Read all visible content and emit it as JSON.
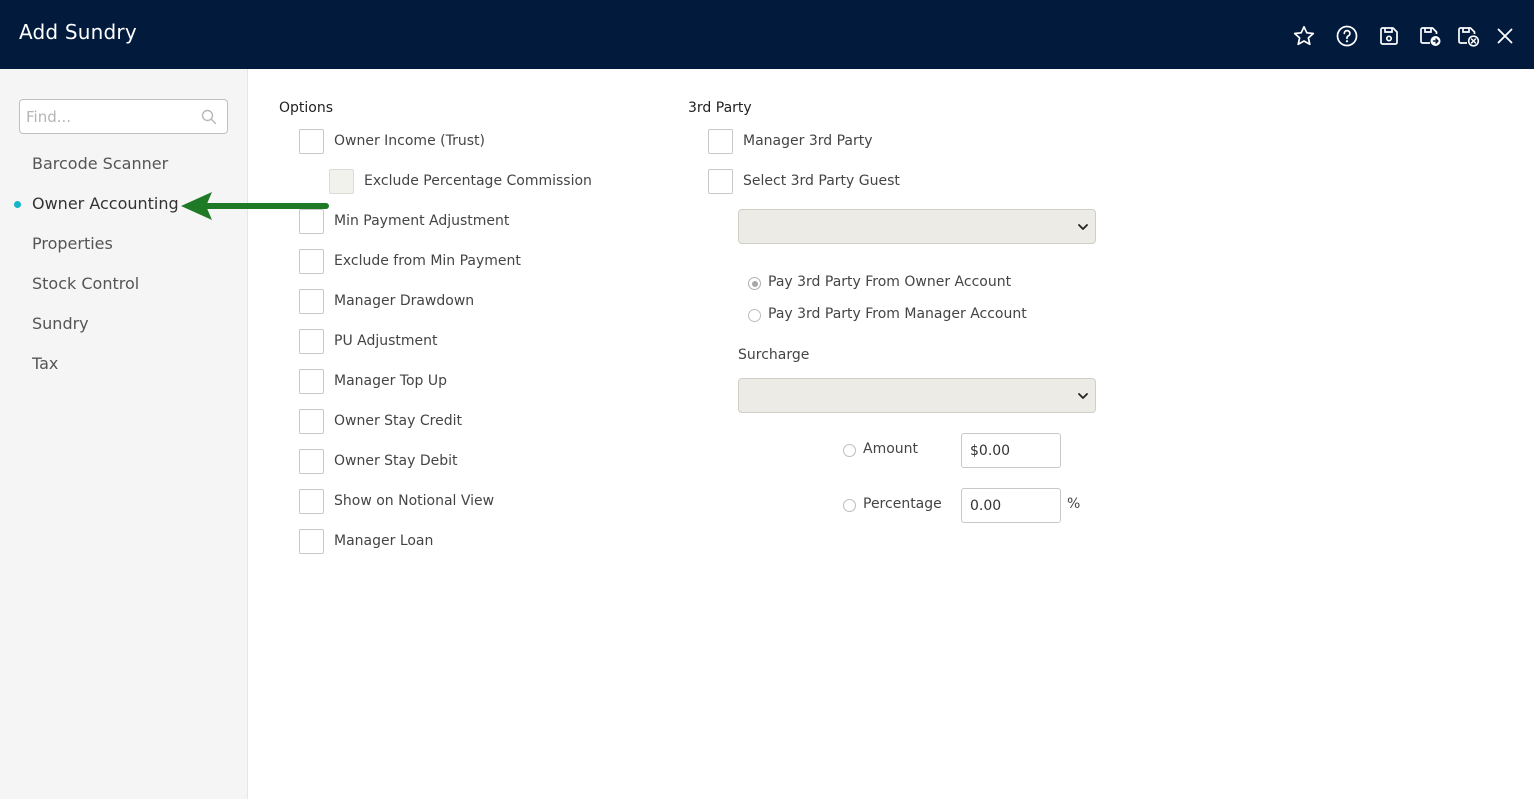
{
  "header": {
    "title": "Add Sundry",
    "icons": [
      "star-icon",
      "help-icon",
      "save-icon",
      "save-and-new-icon",
      "save-and-close-icon",
      "close-icon"
    ]
  },
  "sidebar": {
    "search_placeholder": "Find...",
    "items": [
      {
        "label": "Barcode Scanner",
        "active": false
      },
      {
        "label": "Owner Accounting",
        "active": true
      },
      {
        "label": "Properties",
        "active": false
      },
      {
        "label": "Stock Control",
        "active": false
      },
      {
        "label": "Sundry",
        "active": false
      },
      {
        "label": "Tax",
        "active": false
      }
    ]
  },
  "options": {
    "title": "Options",
    "items": [
      {
        "label": "Owner Income (Trust)",
        "checked": false
      },
      {
        "label": "Exclude Percentage Commission",
        "checked": false,
        "disabled": true
      },
      {
        "label": "Min Payment Adjustment",
        "checked": false
      },
      {
        "label": "Exclude from Min Payment",
        "checked": false
      },
      {
        "label": "Manager Drawdown",
        "checked": false
      },
      {
        "label": "PU Adjustment",
        "checked": false
      },
      {
        "label": "Manager Top Up",
        "checked": false
      },
      {
        "label": "Owner Stay Credit",
        "checked": false
      },
      {
        "label": "Owner Stay Debit",
        "checked": false
      },
      {
        "label": "Show on Notional View",
        "checked": false
      },
      {
        "label": "Manager Loan",
        "checked": false
      }
    ]
  },
  "third_party": {
    "title": "3rd Party",
    "manager_3rd_party": "Manager 3rd Party",
    "select_guest": "Select 3rd Party Guest",
    "guest_select_value": "",
    "pay_from_owner": "Pay 3rd Party From Owner Account",
    "pay_from_manager": "Pay 3rd Party From Manager Account",
    "pay_from_selected": "owner"
  },
  "surcharge": {
    "title": "Surcharge",
    "select_value": "",
    "amount_label": "Amount",
    "amount_value": "$0.00",
    "percentage_label": "Percentage",
    "percentage_value": "0.00",
    "percentage_suffix": "%"
  },
  "colors": {
    "header_bg": "#021b3d",
    "active_dot": "#13b5c6",
    "arrow": "#1e7a25"
  }
}
